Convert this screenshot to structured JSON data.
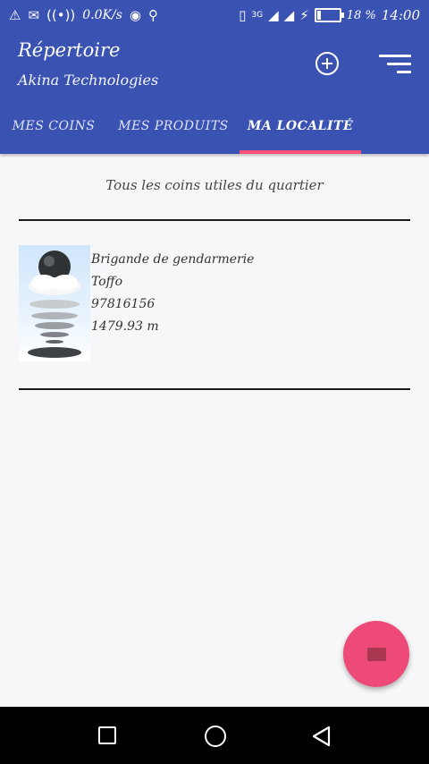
{
  "status_bar": {
    "net_speed": "0.0K/s",
    "network_type": "3G",
    "battery": "18 %",
    "battery_level": 0.18,
    "time": "14:00",
    "icons": [
      "warning-icon",
      "message-icon",
      "hotspot-icon",
      "wifi-icon",
      "location-icon",
      "vibrate-icon",
      "signal-icon",
      "charging-icon",
      "battery-icon"
    ]
  },
  "app_bar": {
    "title": "Répertoire",
    "subtitle": "Akina Technologies",
    "add_icon": "add-circle-icon",
    "sort_icon": "sort-icon"
  },
  "tabs": [
    {
      "label": "MES COINS"
    },
    {
      "label": "MES PRODUITS"
    },
    {
      "label": "MA LOCALITÉ",
      "selected": true
    }
  ],
  "content": {
    "header": "Tous les coins utiles du quartier",
    "items": [
      {
        "name": "Brigande de gendarmerie",
        "location": "Toffo",
        "phone": "97816156",
        "distance": "1479.93 m"
      }
    ]
  },
  "fab": {
    "icon": "mail-icon"
  },
  "nav_bar": {
    "icons": [
      "back-icon",
      "home-icon",
      "recents-icon"
    ]
  },
  "colors": {
    "primary": "#3a53b3",
    "accent": "#ee4a78",
    "indicator": "#ff4f7a"
  }
}
